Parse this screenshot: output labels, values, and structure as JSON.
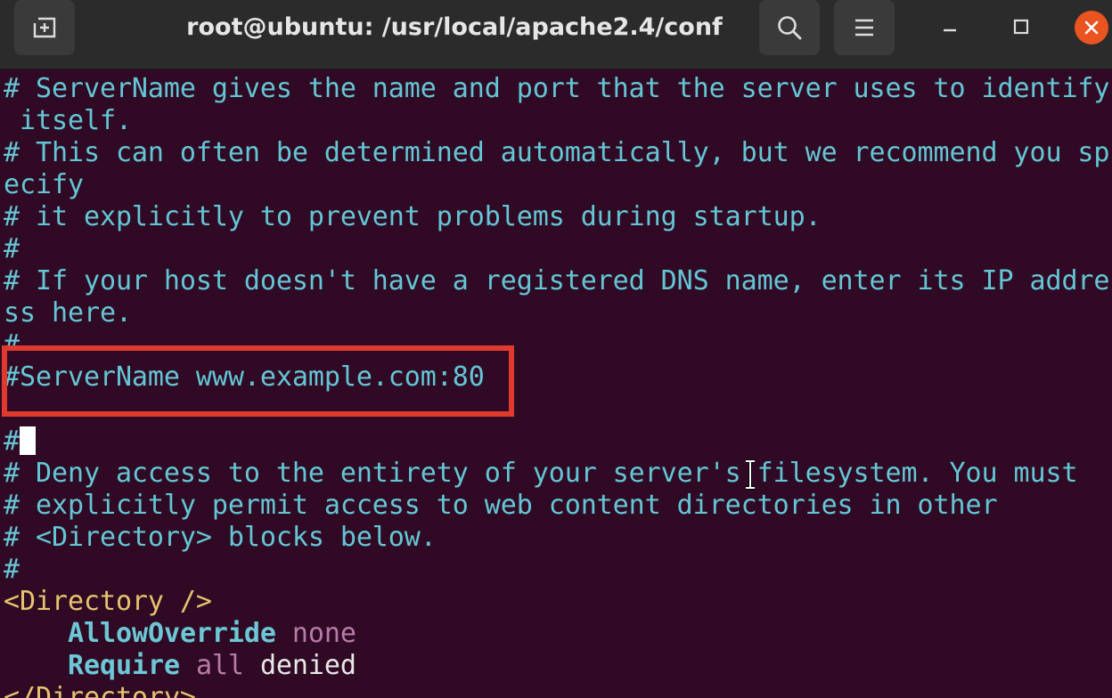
{
  "window": {
    "title": "root@ubuntu: /usr/local/apache2.4/conf"
  },
  "titlebar": {
    "icons": {
      "new_tab": "new-tab-icon",
      "search": "search-icon",
      "menu": "hamburger-menu-icon",
      "minimize": "minimize-icon",
      "maximize": "maximize-icon",
      "close": "close-icon"
    }
  },
  "colors": {
    "terminal_bg": "#300a24",
    "comment": "#63c6d5",
    "tag": "#e6c46e",
    "keyword": "#6cc8d6",
    "value": "#b87aa9",
    "plain": "#e8e8e8",
    "highlight_border": "#e03a2f",
    "close_button": "#e95420"
  },
  "terminal": {
    "lines": [
      "# ServerName gives the name and port that the server uses to identify",
      " itself.",
      "# This can often be determined automatically, but we recommend you sp",
      "ecify",
      "# it explicitly to prevent problems during startup.",
      "#",
      "# If your host doesn't have a registered DNS name, enter its IP addre",
      "ss here.",
      "#",
      "#ServerName www.example.com:80",
      "",
      "#",
      "# Deny access to the entirety of your server's filesystem. You must",
      "# explicitly permit access to web content directories in other",
      "# <Directory> blocks below.",
      "#",
      "<Directory />",
      "AllowOverride",
      "none",
      "Require",
      "all",
      "denied",
      "</Directory>"
    ],
    "highlighted_line": "#ServerName www.example.com:80"
  }
}
